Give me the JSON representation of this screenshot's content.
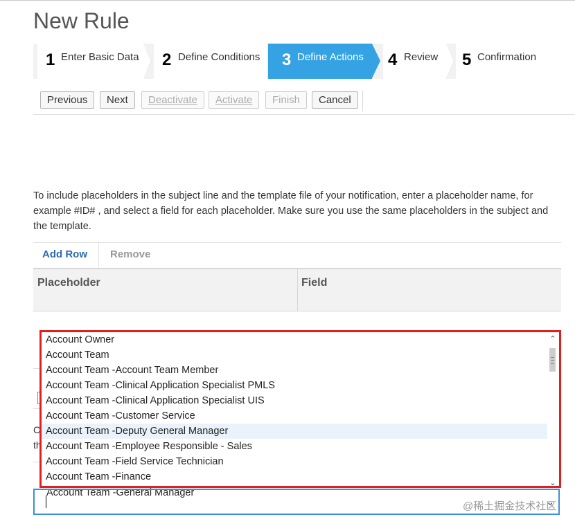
{
  "header": {
    "title": "New Rule"
  },
  "steps": [
    {
      "num": "1",
      "label": "Enter Basic Data"
    },
    {
      "num": "2",
      "label": "Define Conditions"
    },
    {
      "num": "3",
      "label": "Define Actions"
    },
    {
      "num": "4",
      "label": "Review"
    },
    {
      "num": "5",
      "label": "Confirmation"
    }
  ],
  "toolbar": {
    "previous": "Previous",
    "next": "Next",
    "deactivate": "Deactivate",
    "activate": "Activate",
    "finish": "Finish",
    "cancel": "Cancel"
  },
  "description": "To include placeholders in the subject line and the template file of your notification, enter a placeholder name, for example #ID# , and select a field for each placeholder. Make sure you use the same placeholders in the subject and the template.",
  "table": {
    "add_row": "Add Row",
    "remove": "Remove",
    "columns": [
      "Placeholder",
      "Field"
    ]
  },
  "background": {
    "c": "C",
    "th": "th"
  },
  "dropdown": {
    "options": [
      "Account Owner",
      "Account Team",
      "Account Team -Account Team Member",
      "Account Team -Clinical Application Specialist PMLS",
      "Account Team -Clinical Application Specialist UIS",
      "Account Team -Customer Service",
      "Account Team -Deputy General Manager",
      "Account Team -Employee Responsible - Sales",
      "Account Team -Field Service Technician",
      "Account Team -Finance"
    ],
    "partial_option": "Account Team -General Manager",
    "highlighted_index": 6
  },
  "watermark": "@稀土掘金技术社区"
}
